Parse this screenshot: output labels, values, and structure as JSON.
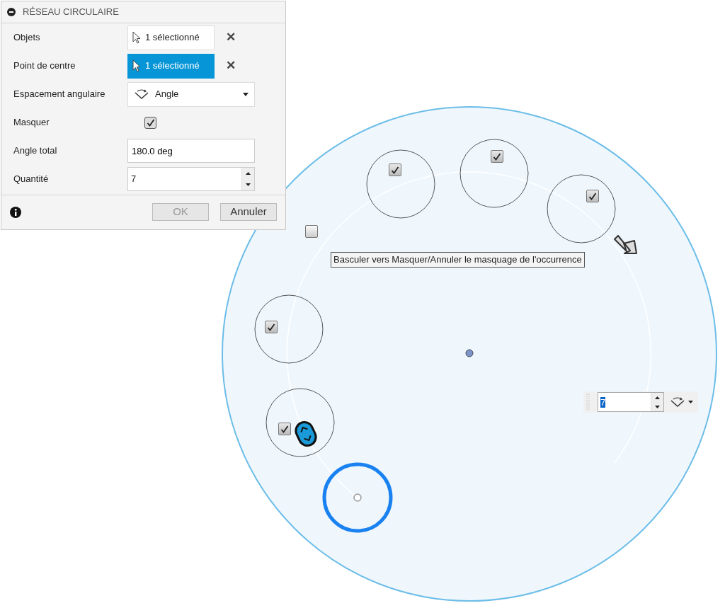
{
  "panel": {
    "title": "RÉSEAU CIRCULAIRE",
    "rows": [
      {
        "kind": "select",
        "label": "Objets",
        "value": "1 sélectionné",
        "active": false,
        "clear": "✕"
      },
      {
        "kind": "select",
        "label": "Point de centre",
        "value": "1 sélectionné",
        "active": true,
        "clear": "✕"
      },
      {
        "kind": "dropdown",
        "label": "Espacement angulaire",
        "value": "Angle"
      },
      {
        "kind": "checkbox",
        "label": "Masquer",
        "checked": true
      },
      {
        "kind": "text",
        "label": "Angle total",
        "value": "180.0 deg"
      },
      {
        "kind": "spinner",
        "label": "Quantité",
        "value": "7"
      }
    ],
    "buttons": [
      {
        "label": "OK",
        "disabled": true
      },
      {
        "label": "Annuler",
        "disabled": false
      }
    ]
  },
  "canvas": {
    "occurrences": [
      {
        "checked": true
      },
      {
        "checked": true
      },
      {
        "checked": true
      },
      {
        "checked": false
      },
      {
        "checked": true
      },
      {
        "checked": true
      }
    ],
    "tooltip": "Basculer vers Masquer/Annuler le masquage de l'occurrence",
    "quantity_input": {
      "value": "7"
    }
  }
}
